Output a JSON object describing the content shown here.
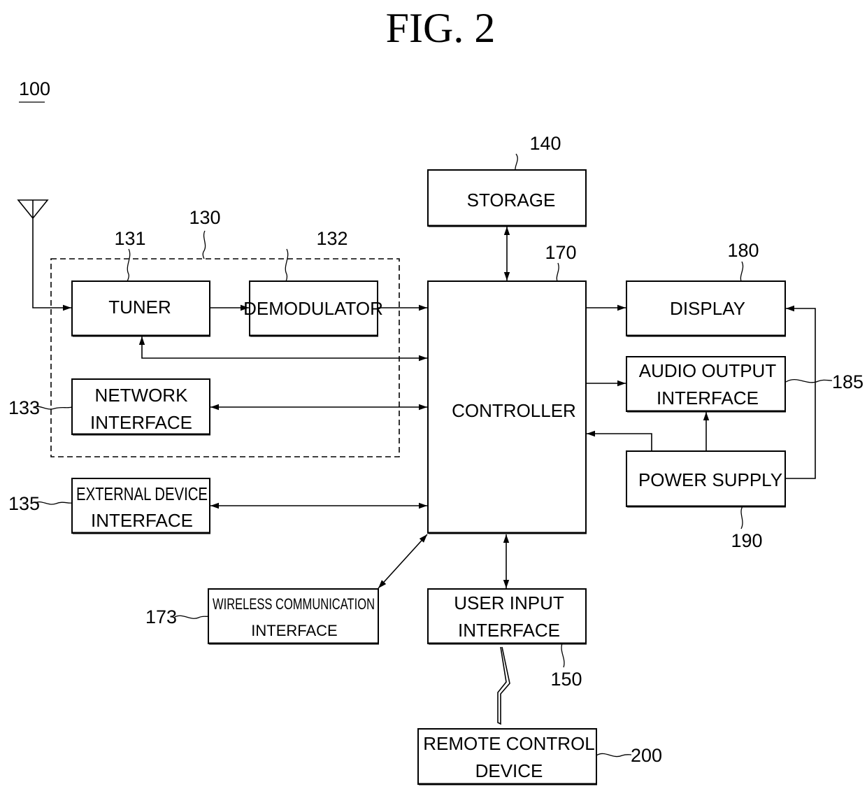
{
  "figure": {
    "title": "FIG. 2",
    "device_ref": "100"
  },
  "blocks": {
    "storage": {
      "label": "STORAGE",
      "ref": "140"
    },
    "tuner": {
      "label": "TUNER",
      "ref": "131"
    },
    "demodulator": {
      "label": "DEMODULATOR",
      "ref": "132"
    },
    "broadcast_receiver": {
      "ref": "130"
    },
    "network_interface": {
      "line1": "NETWORK",
      "line2": "INTERFACE",
      "ref": "133"
    },
    "external_device_interface": {
      "line1": "EXTERNAL DEVICE",
      "line2": "INTERFACE",
      "ref": "135"
    },
    "controller": {
      "label": "CONTROLLER",
      "ref": "170"
    },
    "display": {
      "label": "DISPLAY",
      "ref": "180"
    },
    "audio_output_interface": {
      "line1": "AUDIO OUTPUT",
      "line2": "INTERFACE",
      "ref": "185"
    },
    "power_supply": {
      "label": "POWER SUPPLY",
      "ref": "190"
    },
    "wireless_communication_interface": {
      "line1": "WIRELESS COMMUNICATION",
      "line2": "INTERFACE",
      "ref": "173"
    },
    "user_input_interface": {
      "line1": "USER INPUT",
      "line2": "INTERFACE",
      "ref": "150"
    },
    "remote_control_device": {
      "line1": "REMOTE CONTROL",
      "line2": "DEVICE",
      "ref": "200"
    }
  },
  "connections": [
    {
      "from": "antenna",
      "to": "tuner",
      "direction": "one-way"
    },
    {
      "from": "tuner",
      "to": "demodulator",
      "direction": "one-way"
    },
    {
      "from": "demodulator",
      "to": "controller",
      "direction": "one-way"
    },
    {
      "from": "controller",
      "to": "tuner",
      "direction": "two-way"
    },
    {
      "from": "network_interface",
      "to": "controller",
      "direction": "two-way"
    },
    {
      "from": "external_device_interface",
      "to": "controller",
      "direction": "two-way"
    },
    {
      "from": "storage",
      "to": "controller",
      "direction": "two-way"
    },
    {
      "from": "controller",
      "to": "display",
      "direction": "one-way"
    },
    {
      "from": "controller",
      "to": "audio_output_interface",
      "direction": "one-way"
    },
    {
      "from": "power_supply",
      "to": "controller",
      "direction": "one-way"
    },
    {
      "from": "power_supply",
      "to": "audio_output_interface",
      "direction": "one-way"
    },
    {
      "from": "power_supply",
      "to": "display",
      "direction": "one-way"
    },
    {
      "from": "wireless_communication_interface",
      "to": "controller",
      "direction": "two-way"
    },
    {
      "from": "user_input_interface",
      "to": "controller",
      "direction": "two-way"
    },
    {
      "from": "remote_control_device",
      "to": "user_input_interface",
      "direction": "wireless"
    }
  ]
}
